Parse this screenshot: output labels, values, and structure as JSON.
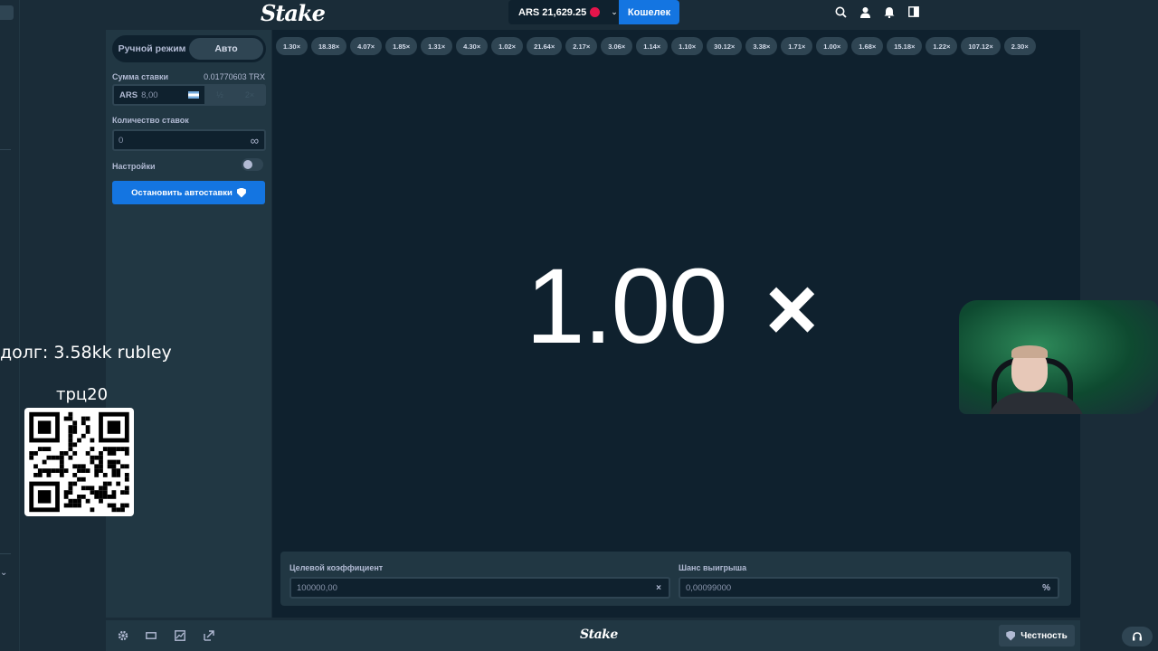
{
  "header": {
    "logo": "Stake",
    "balance": "ARS 21,629.25",
    "wallet_label": "Кошелек"
  },
  "panel": {
    "tabs": [
      {
        "label": "Ручной режим",
        "active": false
      },
      {
        "label": "Авто",
        "active": true
      }
    ],
    "bet_amount_label": "Сумма ставки",
    "bet_amount_crypto": "0.01770603 TRX",
    "bet_currency": "ARS",
    "bet_value": "8,00",
    "half_label": "½",
    "double_label": "2×",
    "bets_count_label": "Количество ставок",
    "bets_count_value": "0",
    "infinity_symbol": "∞",
    "settings_label": "Настройки",
    "stop_autobet_label": "Остановить автоставки"
  },
  "game": {
    "history": [
      "1.30×",
      "18.38×",
      "4.07×",
      "1.85×",
      "1.31×",
      "4.30×",
      "1.02×",
      "21.64×",
      "2.17×",
      "3.06×",
      "1.14×",
      "1.10×",
      "30.12×",
      "3.38×",
      "1.71×",
      "1.00×",
      "1.68×",
      "15.18×",
      "1.22×",
      "107.12×",
      "2.30×"
    ],
    "multiplier": "1.00",
    "multiplier_suffix": "×",
    "target_label": "Целевой коэффициент",
    "target_value": "100000,00",
    "target_suffix": "×",
    "chance_label": "Шанс выигрыша",
    "chance_value": "0,00099000",
    "chance_suffix": "%"
  },
  "footer": {
    "logo": "Stake",
    "fairness_label": "Честность"
  },
  "overlay": {
    "debt_text": "долг: 3.58kk rubley",
    "code_text": "трц20"
  },
  "icons": {
    "search": "search-icon",
    "user": "user-icon",
    "bell": "bell-icon",
    "sidebar": "sidebar-toggle-icon",
    "settings": "gear-icon",
    "theatre": "theatre-mode-icon",
    "stats": "stats-icon",
    "popout": "popout-icon",
    "headset": "headset-icon"
  },
  "colors": {
    "bg": "#1a2c38",
    "panel": "#213743",
    "game_bg": "#0f212e",
    "accent": "#1475e1",
    "pill": "#2f4553"
  }
}
